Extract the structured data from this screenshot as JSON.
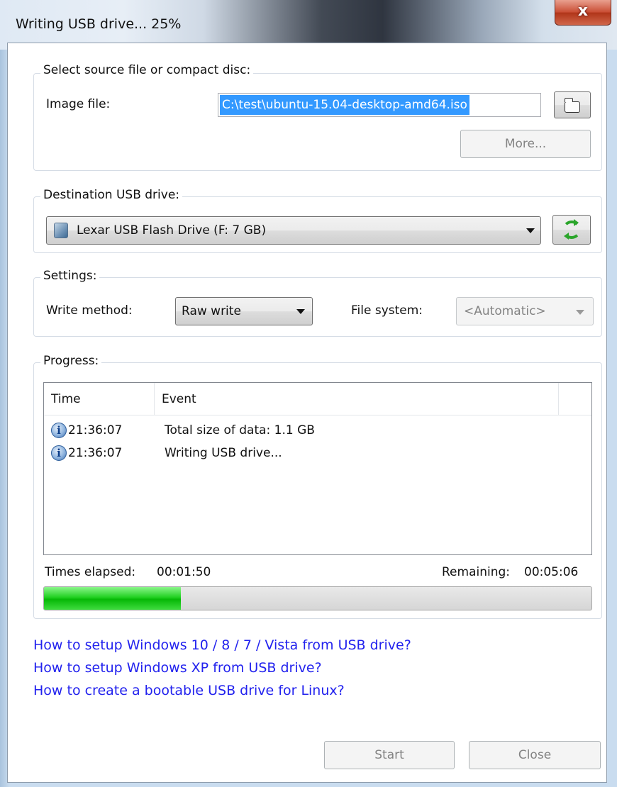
{
  "window": {
    "title": "Writing USB drive... 25%",
    "close_glyph": "x"
  },
  "source": {
    "group_label": "Select source file or compact disc:",
    "image_file_label": "Image file:",
    "image_file_value": "C:\\test\\ubuntu-15.04-desktop-amd64.iso",
    "browse_icon": "folder-icon",
    "more_label": "More..."
  },
  "destination": {
    "group_label": "Destination USB drive:",
    "drive_value": "Lexar USB Flash Drive (F: 7 GB)",
    "drive_icon": "usb-drive-icon",
    "refresh_icon": "refresh-icon"
  },
  "settings": {
    "group_label": "Settings:",
    "write_method_label": "Write method:",
    "write_method_value": "Raw write",
    "file_system_label": "File system:",
    "file_system_value": "<Automatic>"
  },
  "progress": {
    "group_label": "Progress:",
    "columns": [
      "Time",
      "Event"
    ],
    "rows": [
      {
        "icon": "info-icon",
        "time": "21:36:07",
        "event": "Total size of data: 1.1 GB"
      },
      {
        "icon": "info-icon",
        "time": "21:36:07",
        "event": "Writing USB drive..."
      }
    ],
    "elapsed_label": "Times elapsed:",
    "elapsed_value": "00:01:50",
    "remaining_label": "Remaining:",
    "remaining_value": "00:05:06",
    "percent": 25,
    "bar_color": "#22d022"
  },
  "links": [
    "How to setup Windows 10 / 8 / 7 / Vista from USB drive?",
    "How to setup Windows XP from USB drive?",
    "How to create a bootable USB drive for Linux?"
  ],
  "footer": {
    "start_label": "Start",
    "close_label": "Close"
  },
  "colors": {
    "link": "#2222ee",
    "selection": "#3399ff"
  }
}
